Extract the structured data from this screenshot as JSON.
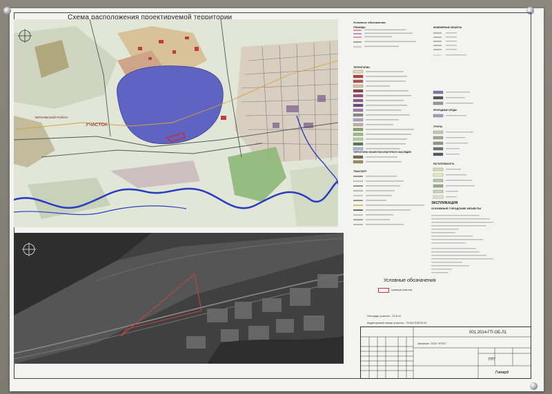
{
  "title": "Схема расположения проектируемой территории",
  "map_labels": {
    "district": "ЧЕРНОВСКИЙ РАЙОН",
    "plot": "УЧАСТОК"
  },
  "legend": {
    "heading": "Условные обозначения",
    "boundaries_heading": "ГРАНИЦЫ",
    "territories_heading": "ТЕРРИТОРИИ",
    "heritage_heading": "ТЕРРИТОРИИ ОБЪЕКТОВ КУЛЬТУРНОГО НАСЛЕДИЯ",
    "transport_heading": "ТРАНСПОРТ",
    "eng_heading": "ИНЖЕНЕРНЫЕ ОБЪЕКТЫ",
    "nature_heading": "ПРИРОДНЫЕ СРЕДЫ",
    "soil_heading": "ГРУНТЫ",
    "veg_heading": "РАСТИТЕЛЬНОСТЬ"
  },
  "explication": {
    "title": "ЭКСПЛИКАЦИЯ",
    "subtitle": "ОСНОВНЫЕ ГОРОДСКИЕ ОБЪЕКТЫ"
  },
  "satellite_legend": {
    "title": "Условные обозначения",
    "boundary_label": "граница участка"
  },
  "area_text": "Площадь участка - 22,5 га",
  "cadastral_text": "Кадастровый номер участка - 75:32:010576:10",
  "stamp": {
    "code": "001.2014-ГП-ОБ.Л1",
    "customer": "Заказчик: ООО \"КТОС\"",
    "stage": "ППТ",
    "logo": "Гитвуд"
  },
  "colors": {
    "lake": "#5f63c2",
    "river": "#2a3fbf",
    "residential": "#cfa58a",
    "red_block": "#c53a3a",
    "green": "#8fb779",
    "olive": "#a89c6a",
    "boundary": "#cc2a2a"
  }
}
